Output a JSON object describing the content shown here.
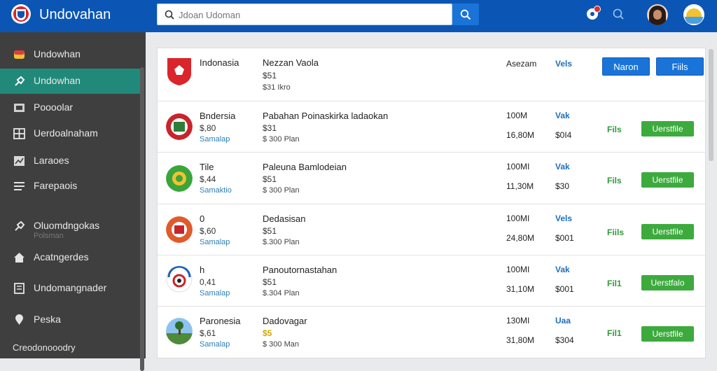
{
  "app": {
    "title": "Undovahan"
  },
  "search": {
    "placeholder": "Jdoan Udoman",
    "value": ""
  },
  "sidebar": {
    "items": [
      {
        "label": "Undowhan",
        "icon": "flag-icon"
      },
      {
        "label": "Undowhan",
        "icon": "pin-icon"
      },
      {
        "label": "Poooolar",
        "icon": "card-icon"
      },
      {
        "label": "Uerdoalnaham",
        "icon": "grid-icon"
      },
      {
        "label": "Laraoes",
        "icon": "chart-icon"
      },
      {
        "label": "Farepaois",
        "icon": "list-icon"
      },
      {
        "label": "Oluomdngokas",
        "icon": "pin-icon"
      },
      {
        "label": "Acatngerdes",
        "icon": "home-icon"
      },
      {
        "label": "Undomangnader",
        "icon": "doc-icon"
      },
      {
        "label": "Peska",
        "icon": "location-icon"
      }
    ],
    "faded_label": "Polsman",
    "footer": "Creodonooodry"
  },
  "rows": [
    {
      "name": "Indonasia",
      "item": "Nezzan Vaola",
      "price": "$51",
      "price2": "$31 Ikro",
      "qty": "Asezam",
      "status": "Vels",
      "btn_left": "Naron",
      "btn_right": "Fiils"
    },
    {
      "name": "Bndersia",
      "sub1": "$,80",
      "sub2": "Samalap",
      "item": "Pabahan Poinaskirka ladaokan",
      "price": "$31",
      "price2": "$ 300 Plan",
      "qty1": "100M",
      "qty2": "16,80M",
      "status": "Vak",
      "status2": "$0I4",
      "tag": "Fils",
      "button": "Uerstfile"
    },
    {
      "name": "Tile",
      "sub1": "$,44",
      "sub2": "Samaktio",
      "item": "Paleuna Bamlodeian",
      "price": "$51",
      "price2": "$ 300 Plan",
      "qty1": "100MI",
      "qty2": "11,30M",
      "status": "Vak",
      "status2": "$30",
      "tag": "Fils",
      "button": "Uerstfile"
    },
    {
      "name": "0",
      "sub1": "$,60",
      "sub2": "Samalap",
      "item": "Dedasisan",
      "price": "$51",
      "price2": "$.300 Plan",
      "qty1": "100MI",
      "qty2": "24,80M",
      "status": "Vels",
      "status2": "$001",
      "tag": "Fiils",
      "button": "Uerstfile"
    },
    {
      "name": "h",
      "sub1": "0,41",
      "sub2": "Samalap",
      "item": "Panoutornastahan",
      "price": "$51",
      "price2": "$.304 Plan",
      "qty1": "100MI",
      "qty2": "31,10M",
      "status": "Vak",
      "status2": "$001",
      "tag": "Fil1",
      "button": "Uerstfalo"
    },
    {
      "name": "Paronesia",
      "sub1": "$,61",
      "sub2": "Samalap",
      "item": "Dadovagar",
      "price": "$5",
      "price2": "$ 300 Man",
      "qty1": "130MI",
      "qty2": "31,80M",
      "status": "Uaa",
      "status2": "$304",
      "tag": "Fil1",
      "button": "Uerstfile"
    }
  ],
  "colors": {
    "header": "#0b56b4",
    "sidebar": "#3f3f3f",
    "sidebar_active": "#21897a",
    "primary": "#1a74d8",
    "success": "#3daa3d"
  }
}
